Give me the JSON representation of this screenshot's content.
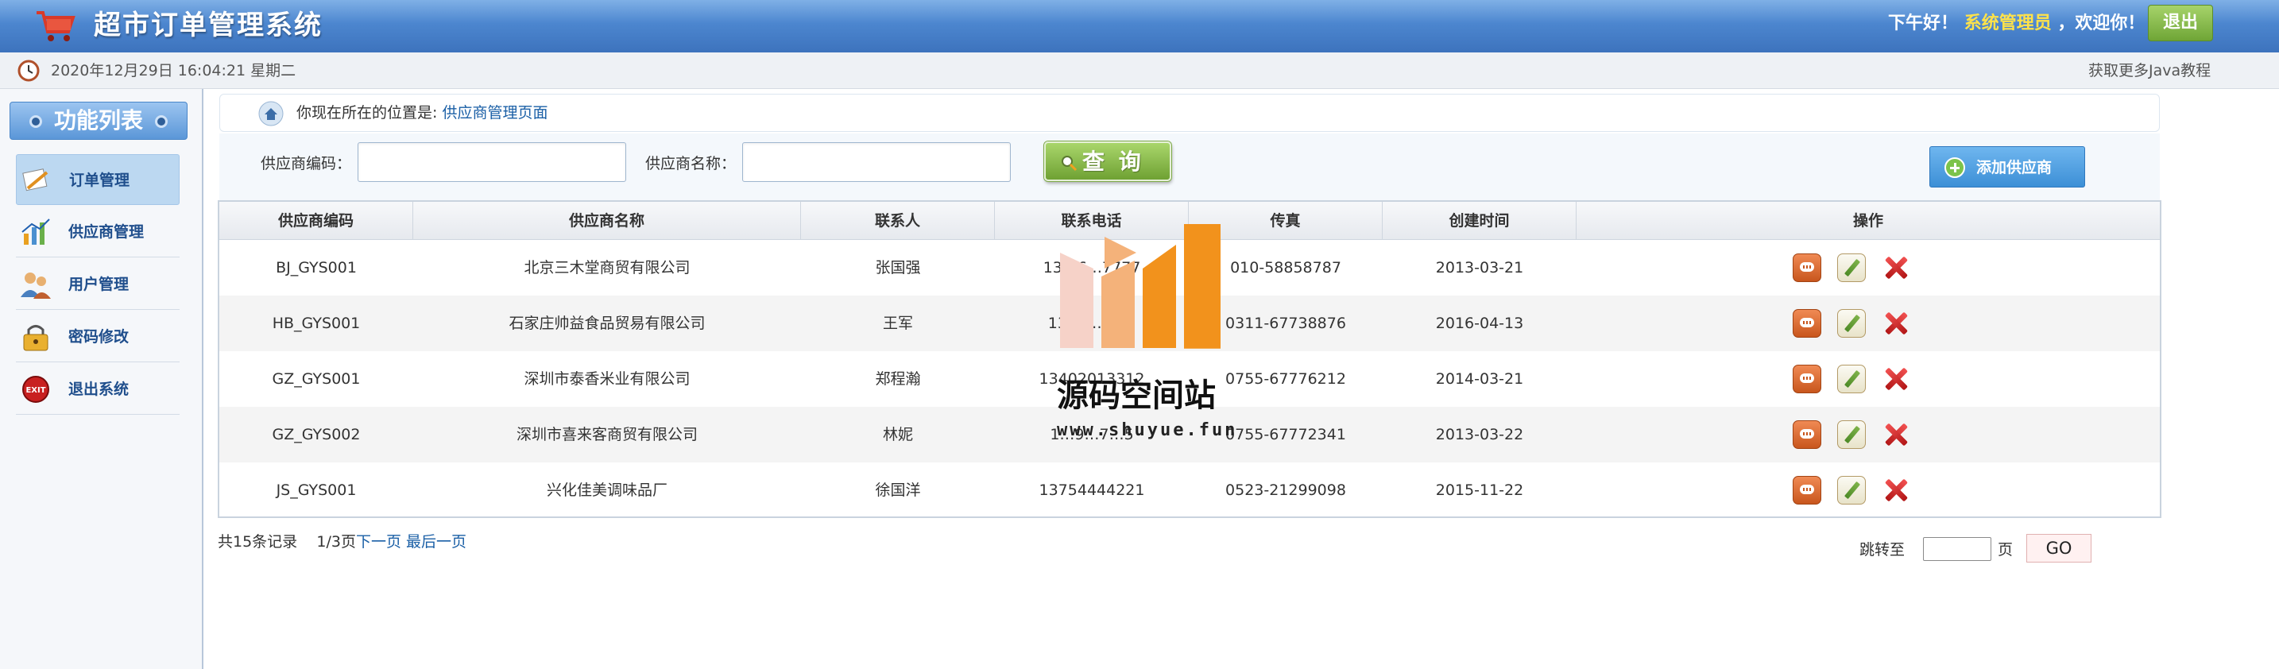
{
  "header": {
    "title": "超市订单管理系统",
    "greeting_prefix": "下午好！",
    "user_name": "系统管理员",
    "greeting_suffix": "，欢迎你！",
    "logout_label": "退出",
    "icon": "shopping-cart-icon"
  },
  "subbar": {
    "datetime": "2020年12月29日 16:04:21 星期二",
    "java_link": "获取更多Java教程",
    "icon": "clock-icon"
  },
  "sidebar": {
    "title": "功能列表",
    "items": [
      {
        "label": "订单管理",
        "icon": "order-note-icon",
        "active": true
      },
      {
        "label": "供应商管理",
        "icon": "supplier-chart-icon",
        "active": false
      },
      {
        "label": "用户管理",
        "icon": "users-icon",
        "active": false
      },
      {
        "label": "密码修改",
        "icon": "lock-icon",
        "active": false
      },
      {
        "label": "退出系统",
        "icon": "exit-icon",
        "active": false
      }
    ]
  },
  "location": {
    "prefix": "你现在所在的位置是:",
    "current": "供应商管理页面",
    "icon": "home-icon"
  },
  "search": {
    "code_label": "供应商编码：",
    "code_value": "",
    "name_label": "供应商名称：",
    "name_value": "",
    "query_label": "查 询",
    "add_label": "添加供应商"
  },
  "table": {
    "headers": [
      "供应商编码",
      "供应商名称",
      "联系人",
      "联系电话",
      "传真",
      "创建时间",
      "操作"
    ],
    "rows": [
      [
        "BJ_GYS001",
        "北京三木堂商贸有限公司",
        "张国强",
        "13…6…7777",
        "010-58858787",
        "2013-03-21"
      ],
      [
        "HB_GYS001",
        "石家庄帅益食品贸易有限公司",
        "王军",
        "13…0…421",
        "0311-67738876",
        "2016-04-13"
      ],
      [
        "GZ_GYS001",
        "深圳市泰香米业有限公司",
        "郑程瀚",
        "13402013312",
        "0755-67776212",
        "2014-03-21"
      ],
      [
        "GZ_GYS002",
        "深圳市喜来客商贸有限公司",
        "林妮",
        "1…9…7…5",
        "0755-67772341",
        "2013-03-22"
      ],
      [
        "JS_GYS001",
        "兴化佳美调味品厂",
        "徐国洋",
        "13754444221",
        "0523-21299098",
        "2015-11-22"
      ]
    ]
  },
  "pagination": {
    "total": "共15条记录",
    "page": "1/3页",
    "next": "下一页",
    "last": "最后一页",
    "jump_label": "跳转至",
    "jump_value": "",
    "unit": "页",
    "go_label": "GO"
  },
  "watermark": {
    "text": "源码空间站",
    "url": "www.shuyue.fun",
    "colors": [
      "#f6d2c8",
      "#f4b27a",
      "#f2921c"
    ]
  },
  "colors": {
    "header_blue": "#4c86cf",
    "link_blue": "#1a5fa6",
    "query_green": "#6fa133",
    "add_blue": "#3c8fd6",
    "delete_red": "#d02020"
  }
}
